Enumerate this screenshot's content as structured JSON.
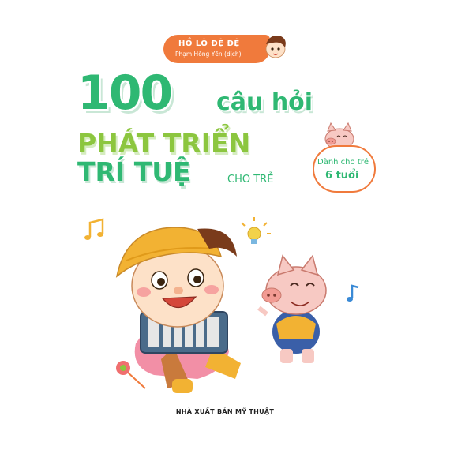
{
  "cover": {
    "author": "HỒ LÔ ĐỆ ĐỆ",
    "translator": "Phạm Hồng Yến (dịch)",
    "title_number": "100",
    "title_word": "câu hỏi",
    "title_line1": "PHÁT TRIỂN",
    "title_line2": "TRÍ TUỆ",
    "title_suffix": "CHO TRẺ",
    "age_label": "Dành cho trẻ",
    "age_value": "6 tuổi",
    "publisher": "NHÀ XUẤT BẢN MỸ THUẬT"
  },
  "colors": {
    "green": "#2fb873",
    "light_green": "#8cc63f",
    "orange": "#f07a3c",
    "pink": "#f4b7b3",
    "yellow": "#f2b233"
  },
  "icons": [
    "boy-head-icon",
    "pig-icon",
    "music-note-icon",
    "lightbulb-icon",
    "accordion-icon",
    "lollipop-icon"
  ]
}
